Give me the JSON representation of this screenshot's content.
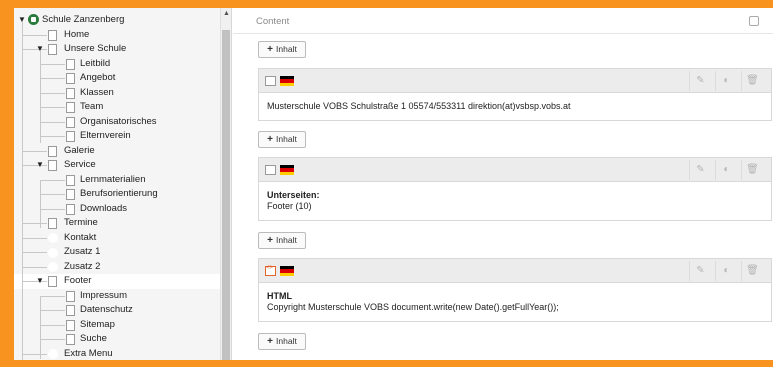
{
  "tree": {
    "items": [
      {
        "label": "Schule Zanzenberg",
        "depth": 0,
        "caret": true,
        "icon": "site-root-icon"
      },
      {
        "label": "Home",
        "depth": 1,
        "icon": "page-icon"
      },
      {
        "label": "Unsere Schule",
        "depth": 1,
        "caret": true,
        "icon": "page-icon"
      },
      {
        "label": "Leitbild",
        "depth": 2,
        "icon": "page-icon"
      },
      {
        "label": "Angebot",
        "depth": 2,
        "icon": "page-icon"
      },
      {
        "label": "Klassen",
        "depth": 2,
        "icon": "page-icon"
      },
      {
        "label": "Team",
        "depth": 2,
        "icon": "page-icon"
      },
      {
        "label": "Organisatorisches",
        "depth": 2,
        "icon": "page-icon"
      },
      {
        "label": "Elternverein",
        "depth": 2,
        "icon": "page-icon"
      },
      {
        "label": "Galerie",
        "depth": 1,
        "icon": "page-icon"
      },
      {
        "label": "Service",
        "depth": 1,
        "caret": true,
        "icon": "page-icon"
      },
      {
        "label": "Lernmaterialien",
        "depth": 2,
        "icon": "page-icon"
      },
      {
        "label": "Berufsorientierung",
        "depth": 2,
        "icon": "page-icon"
      },
      {
        "label": "Downloads",
        "depth": 2,
        "icon": "page-icon"
      },
      {
        "label": "Termine",
        "depth": 1,
        "icon": "page-icon"
      },
      {
        "label": "Kontakt",
        "depth": 1,
        "icon": "restricted-page-icon"
      },
      {
        "label": "Zusatz 1",
        "depth": 1,
        "icon": "restricted-page-icon"
      },
      {
        "label": "Zusatz 2",
        "depth": 1,
        "icon": "restricted-page-icon"
      },
      {
        "label": "Footer",
        "depth": 1,
        "caret": true,
        "icon": "page-icon",
        "selected": true
      },
      {
        "label": "Impressum",
        "depth": 2,
        "icon": "page-icon"
      },
      {
        "label": "Datenschutz",
        "depth": 2,
        "icon": "page-icon"
      },
      {
        "label": "Sitemap",
        "depth": 2,
        "icon": "page-icon"
      },
      {
        "label": "Suche",
        "depth": 2,
        "icon": "page-icon"
      },
      {
        "label": "Extra Menu",
        "depth": 1,
        "icon": "restricted-page-icon"
      }
    ]
  },
  "content": {
    "column_title": "Content",
    "add_label": "Inhalt",
    "elements": [
      {
        "type_icon": "text-ce-icon",
        "language_flag": "german-flag-icon",
        "heading": "",
        "text": "Musterschule VOBS Schulstraße 1 05574/553311 direktion(at)vsbsp.vobs.at"
      },
      {
        "type_icon": "menu-ce-icon",
        "language_flag": "german-flag-icon",
        "heading": "Unterseiten:",
        "text": "Footer (10)"
      },
      {
        "type_icon": "html-ce-icon",
        "language_flag": "german-flag-icon",
        "heading": "HTML",
        "text": "Copyright Musterschule VOBS document.write(new Date().getFullYear());"
      }
    ]
  },
  "colors": {
    "frame": "#f7931e",
    "selected_row": "#ffffff",
    "restricted": "#c9302c",
    "root_icon": "#2a7a3b"
  }
}
